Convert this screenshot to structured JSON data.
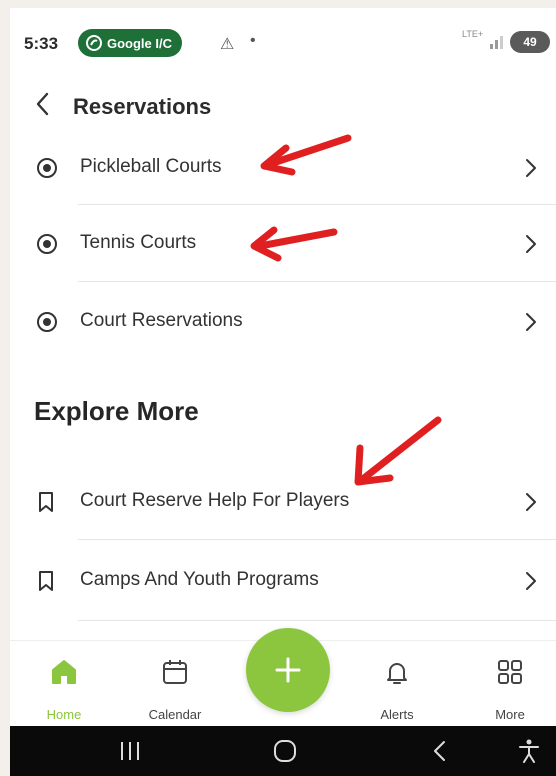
{
  "status_bar": {
    "time": "5:33",
    "notification_pill": "Google I/C",
    "warning_glyph": "⚠",
    "dot_glyph": "•",
    "network_label": "LTE+",
    "battery_level": "49"
  },
  "header": {
    "title": "Reservations",
    "back_icon": "chevron-left-icon"
  },
  "reservations": [
    {
      "label": "Pickleball Courts",
      "icon": "radio-dot-icon"
    },
    {
      "label": "Tennis Courts",
      "icon": "radio-dot-icon"
    },
    {
      "label": "Court Reservations",
      "icon": "radio-dot-icon"
    }
  ],
  "explore": {
    "title": "Explore More",
    "items": [
      {
        "label": "Court Reserve Help For Players",
        "icon": "bookmark-icon"
      },
      {
        "label": "Camps And Youth Programs",
        "icon": "bookmark-icon"
      }
    ]
  },
  "bottom_nav": {
    "items": [
      {
        "label": "Home",
        "icon": "home-icon",
        "active": true
      },
      {
        "label": "Calendar",
        "icon": "calendar-icon",
        "active": false
      },
      {
        "label": "Alerts",
        "icon": "bell-icon",
        "active": false
      },
      {
        "label": "More",
        "icon": "grid-icon",
        "active": false
      }
    ],
    "fab_icon": "plus-icon"
  },
  "colors": {
    "accent_green": "#8cc63f",
    "pill_green": "#1f6f38",
    "annotation_red": "#e02020"
  }
}
